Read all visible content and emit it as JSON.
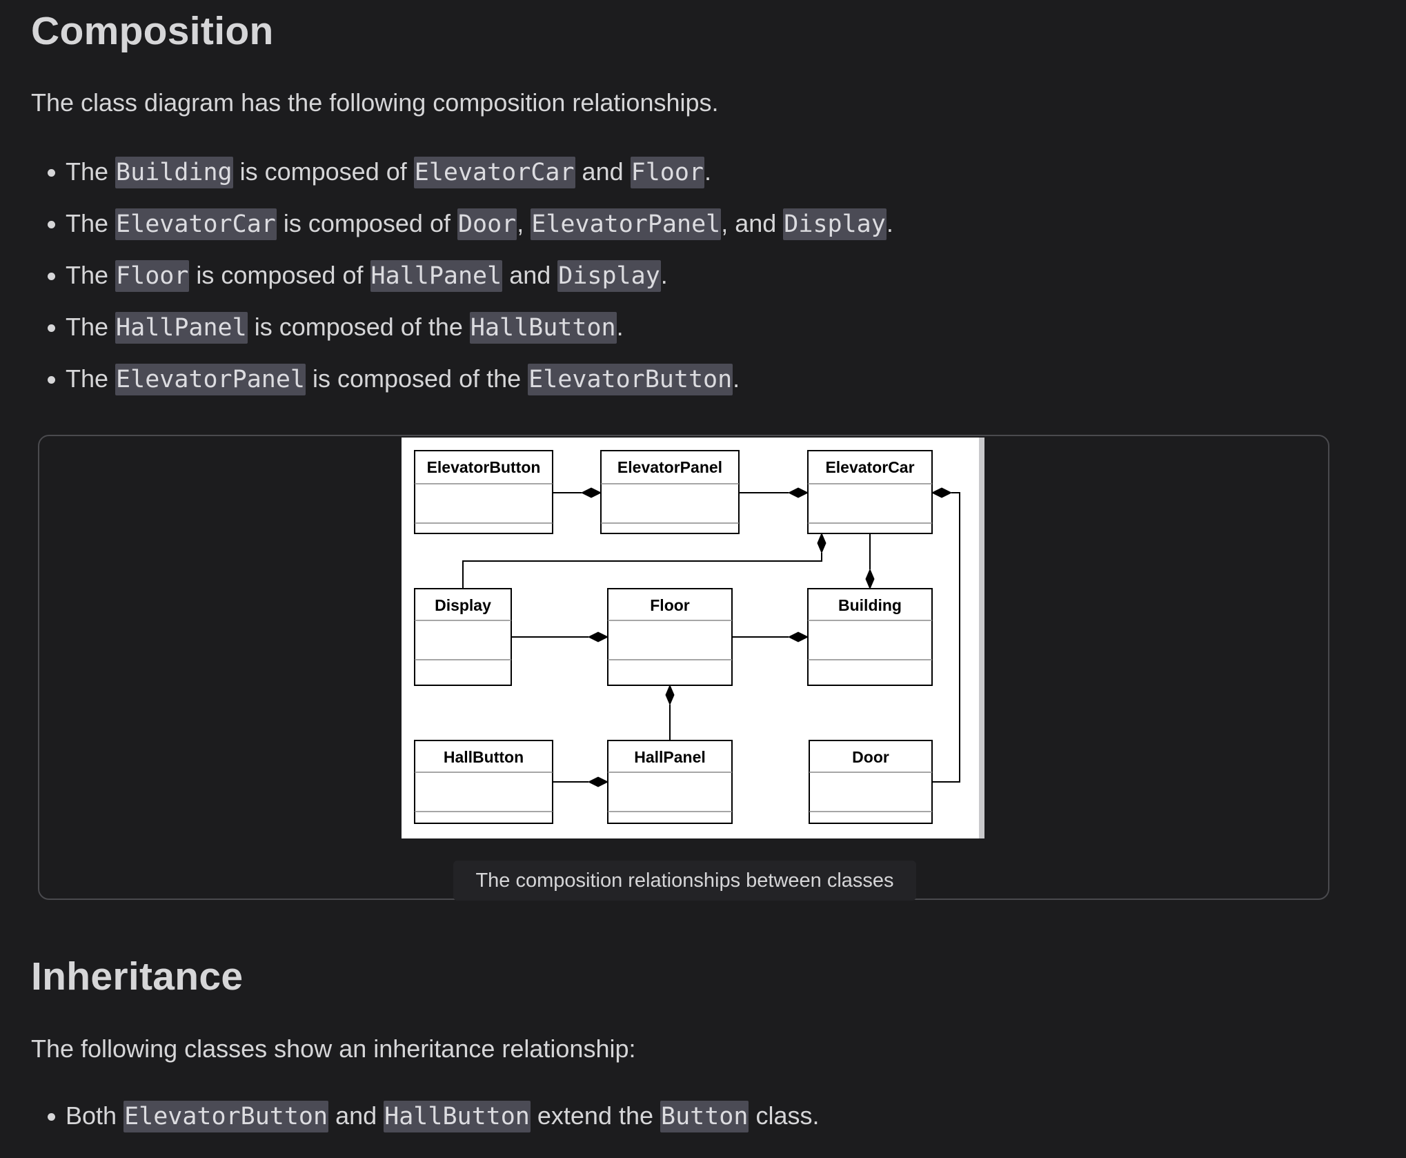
{
  "composition": {
    "heading": "Composition",
    "intro": "The class diagram has the following composition relationships.",
    "bullets": [
      {
        "w0": "The ",
        "c0": "Building",
        "w1": " is composed of ",
        "c1": "ElevatorCar",
        "w2": " and ",
        "c2": "Floor",
        "w3": "."
      },
      {
        "w0": "The ",
        "c0": "ElevatorCar",
        "w1": " is composed of ",
        "c1": "Door",
        "w2": ", ",
        "c2": "ElevatorPanel",
        "w3": ", and ",
        "c3": "Display",
        "w4": "."
      },
      {
        "w0": "The ",
        "c0": "Floor",
        "w1": " is composed of ",
        "c1": "HallPanel",
        "w2": " and ",
        "c2": "Display",
        "w3": "."
      },
      {
        "w0": "The ",
        "c0": "HallPanel",
        "w1": " is composed of the ",
        "c1": "HallButton",
        "w2": "."
      },
      {
        "w0": "The ",
        "c0": "ElevatorPanel",
        "w1": " is composed of the ",
        "c1": "ElevatorButton",
        "w2": "."
      }
    ],
    "figure": {
      "classes": {
        "elevator_button": "ElevatorButton",
        "elevator_panel": "ElevatorPanel",
        "elevator_car": "ElevatorCar",
        "display": "Display",
        "floor": "Floor",
        "building": "Building",
        "hall_button": "HallButton",
        "hall_panel": "HallPanel",
        "door": "Door"
      },
      "caption": "The composition relationships between classes"
    }
  },
  "inheritance": {
    "heading": "Inheritance",
    "intro": "The following classes show an inheritance relationship:",
    "bullets": [
      {
        "w0": "Both ",
        "c0": "ElevatorButton",
        "w1": " and ",
        "c1": "HallButton",
        "w2": " extend the ",
        "c2": "Button",
        "w3": " class."
      }
    ]
  }
}
